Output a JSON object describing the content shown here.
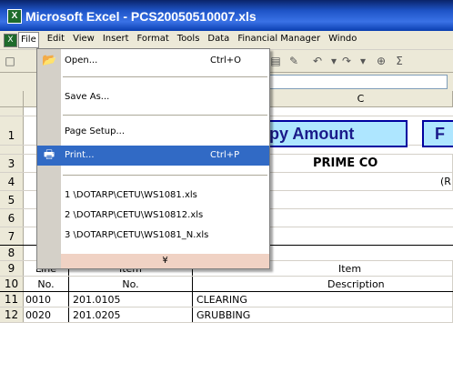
{
  "window": {
    "title": "Microsoft Excel - PCS20050510007.xls",
    "app_icon": "X"
  },
  "menubar": {
    "doc_icon": "X",
    "items": [
      "File",
      "Edit",
      "View",
      "Insert",
      "Format",
      "Tools",
      "Data",
      "Financial Manager",
      "Windo"
    ]
  },
  "file_menu": {
    "open": {
      "label": "Open...",
      "shortcut": "Ctrl+O"
    },
    "save_as": "Save As...",
    "page_setup": "Page Setup...",
    "print": {
      "label": "Print...",
      "shortcut": "Ctrl+P"
    },
    "recent": [
      "1 \\DOTARP\\CETU\\WS1081.xls",
      "2 \\DOTARP\\CETU\\WS10812.xls",
      "3 \\DOTARP\\CETU\\WS1081_N.xls"
    ],
    "more_glyph": "¥",
    "highlight_color": "#316ac5"
  },
  "sheet": {
    "col_c": "C",
    "row_numbers": [
      "",
      "1",
      "",
      "3",
      "4",
      "5",
      "6",
      "7",
      "8",
      "9",
      "10",
      "11",
      "12"
    ],
    "copy_amount": "py Amount",
    "f_box": "F",
    "prime": "PRIME CO",
    "paren": "(R",
    "line_hdr1": "Line",
    "line_hdr2": "No.",
    "item_hdr1": "Item",
    "item_hdr2": "No.",
    "item_desc1": "Item",
    "item_desc2": "Description",
    "row11": {
      "line": "0010",
      "item": "201.0105",
      "desc": "CLEARING"
    },
    "row12": {
      "line": "0020",
      "item": "201.0205",
      "desc": "GRUBBING"
    },
    "box_color": "#aee6ff"
  }
}
